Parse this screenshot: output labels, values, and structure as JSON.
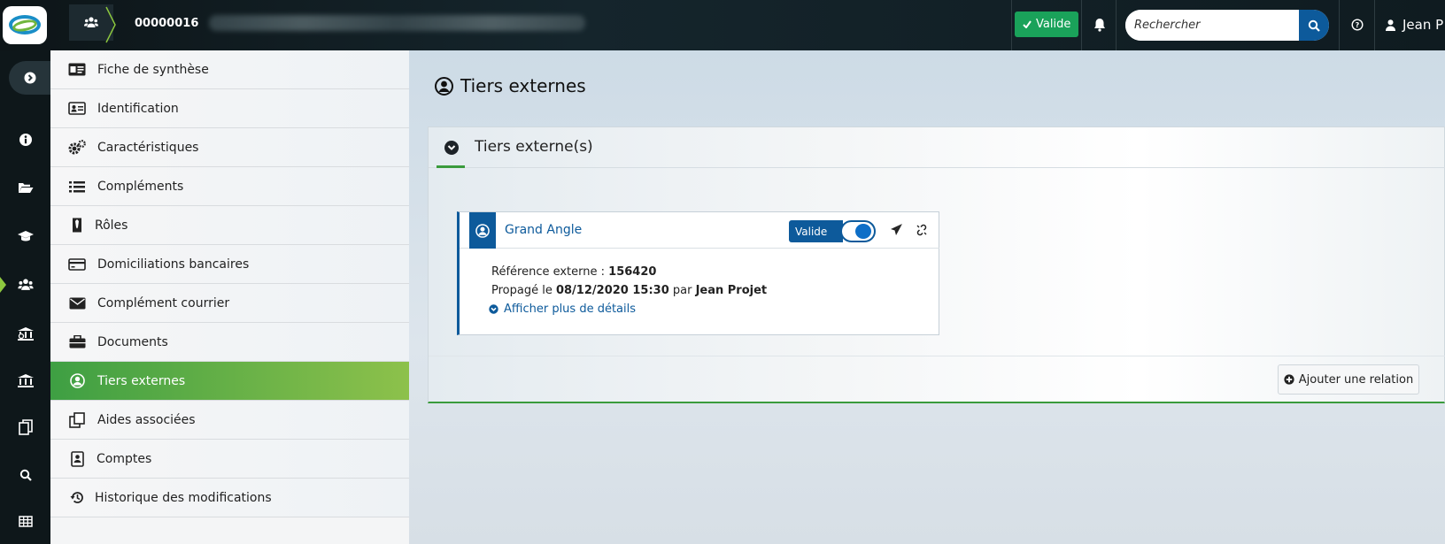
{
  "topbar": {
    "dossier_number": "00000016",
    "status_label": "Valide",
    "search_placeholder": "Rechercher",
    "user_name": "Jean P"
  },
  "menu": {
    "items": [
      {
        "label": "Fiche de synthèse",
        "icon": "id-card-icon"
      },
      {
        "label": "Identification",
        "icon": "address-card-icon"
      },
      {
        "label": "Caractéristiques",
        "icon": "gears-icon"
      },
      {
        "label": "Compléments",
        "icon": "list-icon"
      },
      {
        "label": "Rôles",
        "icon": "tie-icon"
      },
      {
        "label": "Domiciliations bancaires",
        "icon": "credit-card-icon"
      },
      {
        "label": "Complément courrier",
        "icon": "envelope-icon"
      },
      {
        "label": "Documents",
        "icon": "briefcase-icon"
      },
      {
        "label": "Tiers externes",
        "icon": "user-circle-icon",
        "active": true
      },
      {
        "label": "Aides associées",
        "icon": "clone-icon"
      },
      {
        "label": "Comptes",
        "icon": "portrait-icon"
      },
      {
        "label": "Historique des modifications",
        "icon": "history-icon"
      }
    ]
  },
  "main": {
    "page_title": "Tiers externes",
    "panel_title": "Tiers externe(s)",
    "card": {
      "name": "Grand Angle",
      "status": "Valide",
      "ref_label": "Référence externe : ",
      "ref_value": "156420",
      "propagated_label": "Propagé le ",
      "propagated_date": "08/12/2020 15:30",
      "by_label": " par ",
      "propagated_by": "Jean Projet",
      "more_link": "Afficher plus de détails"
    },
    "add_relation_label": "Ajouter une relation"
  },
  "colors": {
    "accent_blue": "#0d5a9b",
    "active_green": "#3e9f43",
    "status_green": "#1aa25a"
  }
}
